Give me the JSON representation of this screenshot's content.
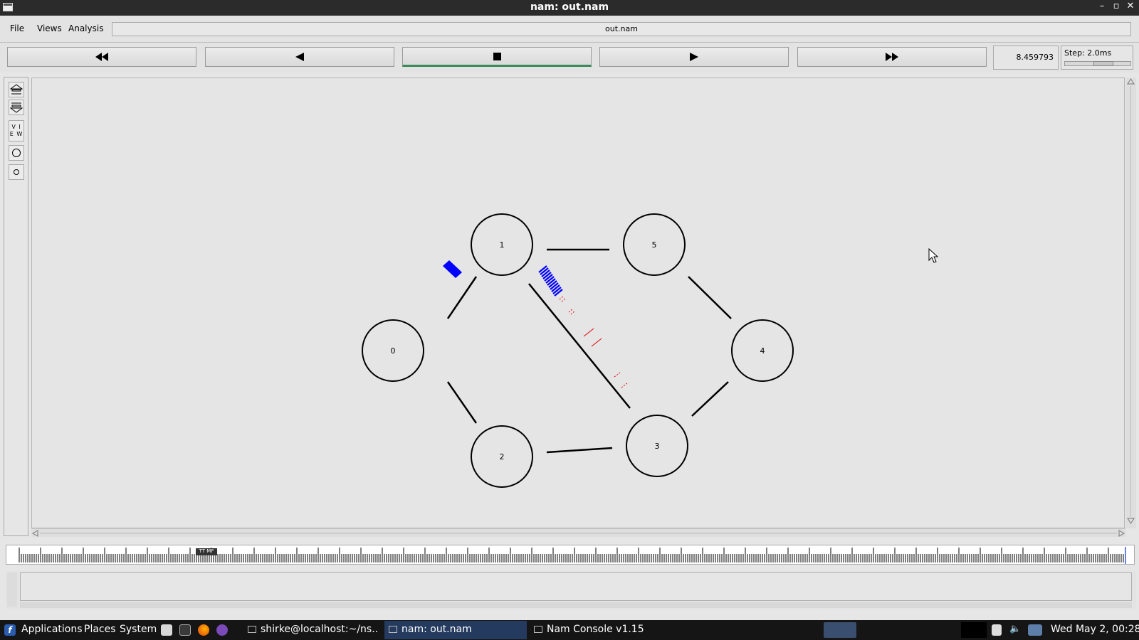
{
  "window": {
    "title": "nam: out.nam"
  },
  "menubar": {
    "file": "File",
    "views": "Views",
    "analysis": "Analysis",
    "filename": "out.nam"
  },
  "playback": {
    "time": "8.459793",
    "step": "Step: 2.0ms"
  },
  "toolbar": {
    "view_label_1": "V I",
    "view_label_2": "E W"
  },
  "topology": {
    "nodes": [
      "0",
      "1",
      "2",
      "3",
      "4",
      "5"
    ],
    "packet_color_flow1": "#0000ff",
    "packet_color_flow2": "#e00000"
  },
  "timeline": {
    "marker": "TT MF"
  },
  "taskbar": {
    "applications": "Applications",
    "places": "Places",
    "system": "System",
    "task_terminal": "shirke@localhost:~/ns...",
    "task_nam": "nam: out.nam",
    "task_console": "Nam Console v1.15",
    "clock": "Wed May  2, 00:28"
  }
}
